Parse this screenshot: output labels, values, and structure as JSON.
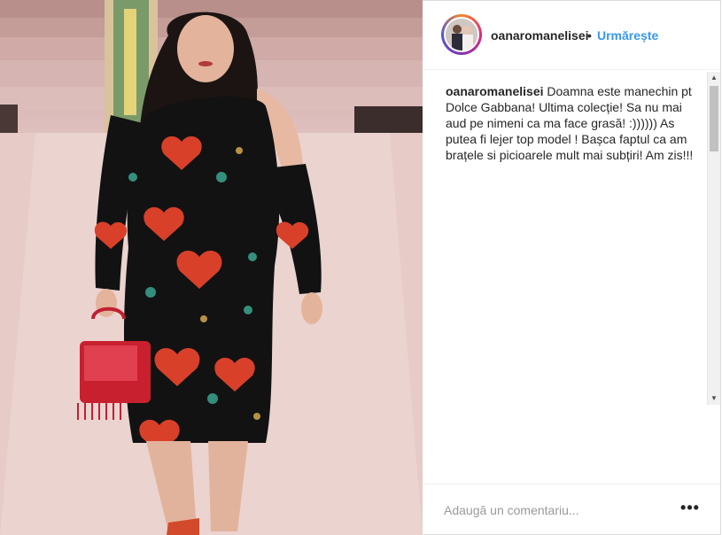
{
  "post": {
    "username": "oanaromanelisei",
    "separator": "•",
    "follow_label": "Urmărește",
    "caption_user": "oanaromanelisei",
    "caption_text": " Doamna este manechin pt Dolce Gabbana! Ultima colecție! Sa nu mai aud pe nimeni ca ma face grasă! :)))))) As putea fi lejer top model ! Bașca faptul ca am brațele si picioarele mult mai subțiri! Am zis!!!"
  },
  "comment": {
    "placeholder": "Adaugă un comentariu...",
    "more_label": "•••"
  },
  "colors": {
    "link_blue": "#3897f0",
    "text": "#262626",
    "placeholder": "#999999"
  },
  "icons": {
    "more": "more-options-icon",
    "scroll_up": "scroll-up-icon",
    "scroll_down": "scroll-down-icon"
  }
}
